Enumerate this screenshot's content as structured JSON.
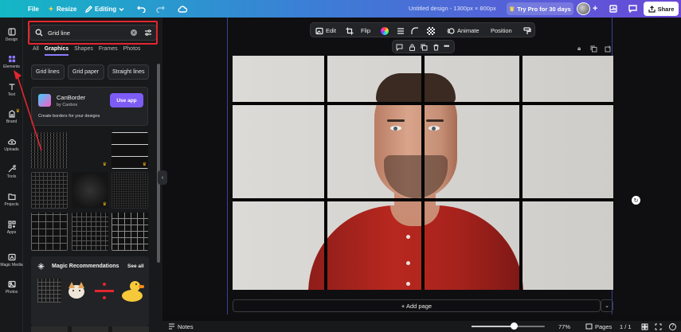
{
  "topbar": {
    "file_label": "File",
    "resize_label": "Resize",
    "editing_label": "Editing",
    "doc_title": "Untitled design - 1300px × 800px",
    "pro_label": "Try Pro for 30 days",
    "share_label": "Share"
  },
  "rail": {
    "items": [
      {
        "label": "Design",
        "icon": "layout-icon"
      },
      {
        "label": "Elements",
        "icon": "shapes-icon"
      },
      {
        "label": "Text",
        "icon": "text-icon"
      },
      {
        "label": "Brand",
        "icon": "brand-icon"
      },
      {
        "label": "Uploads",
        "icon": "upload-icon"
      },
      {
        "label": "Tools",
        "icon": "tools-icon"
      },
      {
        "label": "Projects",
        "icon": "folder-icon"
      },
      {
        "label": "Apps",
        "icon": "apps-icon"
      },
      {
        "label": "Magic Media",
        "icon": "magic-icon"
      },
      {
        "label": "Photos",
        "icon": "photo-icon"
      }
    ]
  },
  "panel": {
    "search_value": "Grid line",
    "tabs": [
      "All",
      "Graphics",
      "Shapes",
      "Frames",
      "Photos"
    ],
    "chips": [
      "Grid lines",
      "Grid paper",
      "Straight lines"
    ],
    "app_card": {
      "name": "CanBorder",
      "by": "by Canbox",
      "use_label": "Use app",
      "desc": "Create borders for your designs"
    },
    "magic": {
      "title": "Magic Recommendations",
      "see_all": "See all"
    }
  },
  "toolbar": {
    "edit_label": "Edit",
    "flip_label": "Flip",
    "animate_label": "Animate",
    "position_label": "Position"
  },
  "canvas": {
    "add_page_label": "+ Add page"
  },
  "bottom": {
    "notes_label": "Notes",
    "zoom": "77%",
    "zoom_fraction": 0.58,
    "pages_label": "Pages",
    "page_count": "1 / 1"
  },
  "colors": {
    "accent": "#8b7bff",
    "highlight": "#e3262f",
    "grid": "#000000"
  }
}
